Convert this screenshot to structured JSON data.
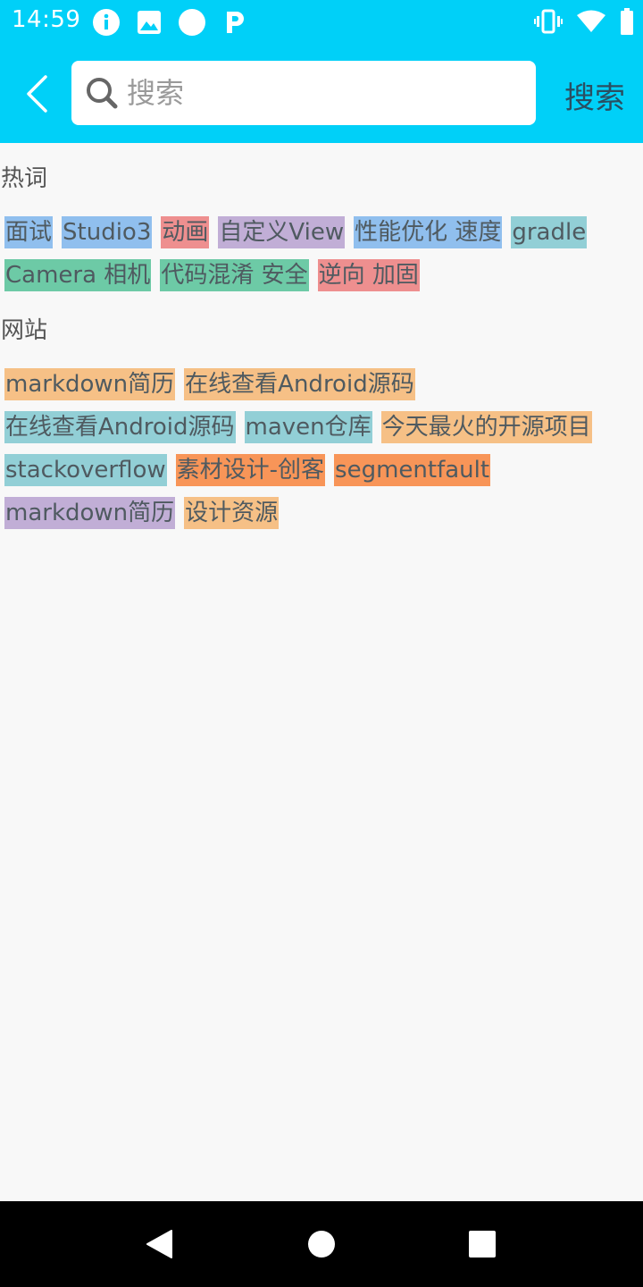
{
  "status_bar": {
    "time": "14:59",
    "left_icons": [
      "info-icon",
      "image-icon",
      "circle-icon",
      "p-icon"
    ],
    "right_icons": [
      "vibrate-icon",
      "wifi-icon",
      "battery-icon"
    ],
    "color": "#00d0f8"
  },
  "app_bar": {
    "back_icon": "chevron-left-icon",
    "search_placeholder": "搜索",
    "search_value": "",
    "search_action_label": "搜索"
  },
  "hot_words": {
    "title": "热词",
    "tags": [
      {
        "label": "面试",
        "color": "#90bfee"
      },
      {
        "label": "Studio3",
        "color": "#90bfee"
      },
      {
        "label": "动画",
        "color": "#ee8f8f"
      },
      {
        "label": "自定义View",
        "color": "#c1aed6"
      },
      {
        "label": "性能优化 速度",
        "color": "#90bfee"
      },
      {
        "label": "gradle",
        "color": "#92cfd6"
      },
      {
        "label": "Camera 相机",
        "color": "#6dcaa6"
      },
      {
        "label": "代码混淆 安全",
        "color": "#6dcaa6"
      },
      {
        "label": "逆向 加固",
        "color": "#ee8f8f"
      }
    ]
  },
  "websites": {
    "title": "网站",
    "tags": [
      {
        "label": "markdown简历",
        "color": "#f6c086"
      },
      {
        "label": "在线查看Android源码",
        "color": "#f6c086"
      },
      {
        "label": "在线查看Android源码",
        "color": "#92cfd6"
      },
      {
        "label": "maven仓库",
        "color": "#92cfd6"
      },
      {
        "label": "今天最火的开源项目",
        "color": "#f6c086"
      },
      {
        "label": "stackoverflow",
        "color": "#92cfd6"
      },
      {
        "label": "素材设计-创客",
        "color": "#f89558"
      },
      {
        "label": "segmentfault",
        "color": "#f89558"
      },
      {
        "label": "markdown简历",
        "color": "#c1aed6"
      },
      {
        "label": "设计资源",
        "color": "#f6c086"
      }
    ]
  },
  "nav_bar": {
    "icons": [
      "back-triangle-icon",
      "home-circle-icon",
      "recents-square-icon"
    ]
  }
}
